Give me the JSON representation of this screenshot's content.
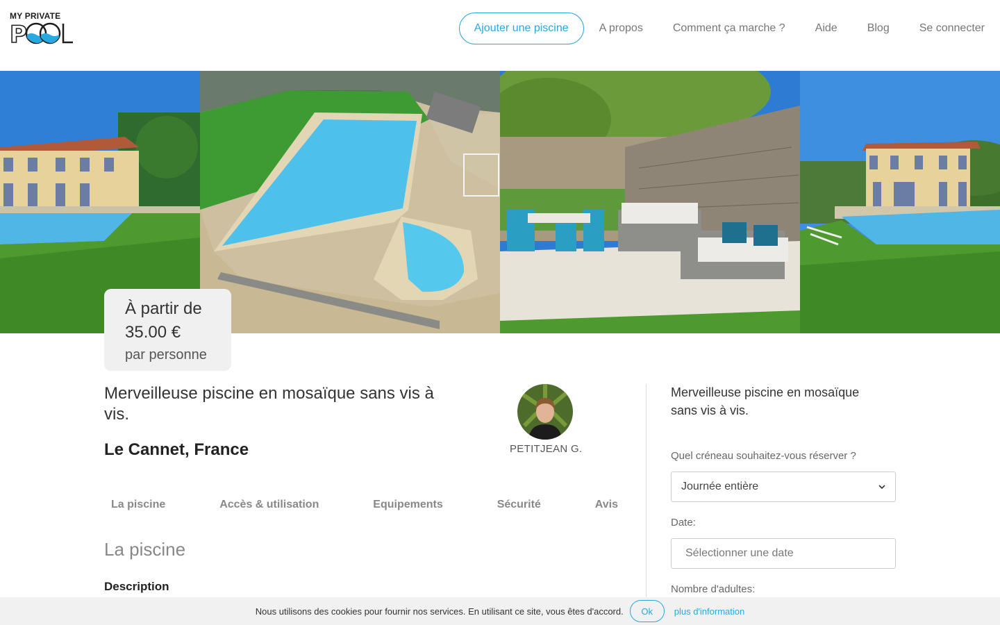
{
  "header": {
    "logo_top": "MY PRIVATE",
    "logo_bottom": "POOL",
    "cta_label": "Ajouter une piscine",
    "nav": [
      "A propos",
      "Comment ça marche ?",
      "Aide",
      "Blog",
      "Se connecter"
    ]
  },
  "gallery": {
    "photos": [
      "villa-pool-photo",
      "pool-closeup-photo",
      "terrace-lounge-photo",
      "villa-pool-photo"
    ]
  },
  "price": {
    "prefix": "À partir de",
    "amount": "35.00 €",
    "unit": "par personne"
  },
  "listing": {
    "title": "Merveilleuse piscine en mosaïque sans vis à vis.",
    "location": "Le Cannet, France",
    "host_name": "PETITJEAN G.",
    "tabs": [
      "La piscine",
      "Accès & utilisation",
      "Equipements",
      "Sécurité",
      "Avis"
    ],
    "section_title": "La piscine",
    "description_label": "Description"
  },
  "booking": {
    "title": "Merveilleuse piscine en mosaïque sans vis à vis.",
    "slot_label": "Quel créneau souhaitez-vous réserver ?",
    "slot_value": "Journée entière",
    "date_label": "Date:",
    "date_placeholder": "Sélectionner une date",
    "adults_label": "Nombre d'adultes:"
  },
  "cookie": {
    "text": "Nous utilisons des cookies pour fournir nos services. En utilisant ce site, vous êtes d'accord.",
    "ok": "Ok",
    "more": "plus d'information"
  },
  "colors": {
    "accent": "#29a8df",
    "price_card_bg": "#f0f0f0",
    "cookie_bg": "#f1f1f1"
  }
}
